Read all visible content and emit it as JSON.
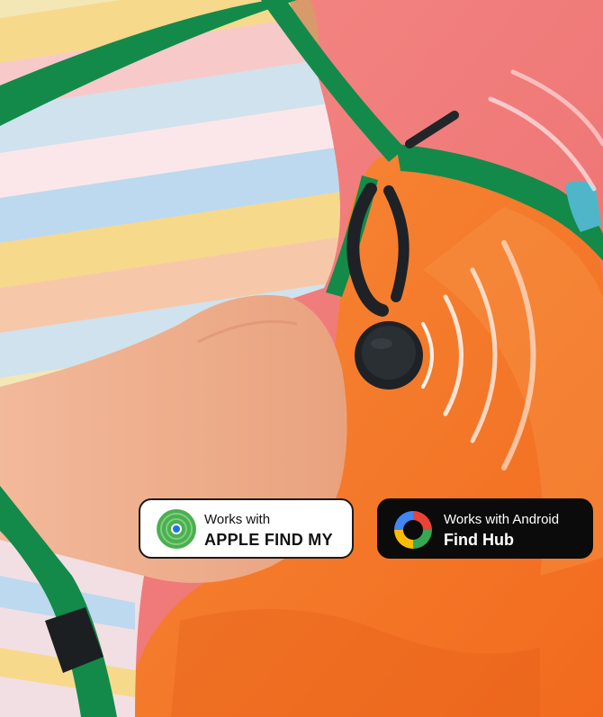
{
  "scene": {
    "background_color": "#f07a7a",
    "backpack_color": "#f47a2a",
    "strap_color": "#138a4a",
    "tracker_color": "#1e2226"
  },
  "badges": {
    "apple": {
      "line1": "Works with",
      "line2": "APPLE FIND MY",
      "icon": "find-my-icon",
      "colors": {
        "background": "#ffffff",
        "text": "#111111"
      }
    },
    "google": {
      "line1": "Works with Android",
      "line2": "Find Hub",
      "icon": "find-hub-icon",
      "colors": {
        "background": "#0b0b0b",
        "text": "#ffffff"
      }
    }
  }
}
